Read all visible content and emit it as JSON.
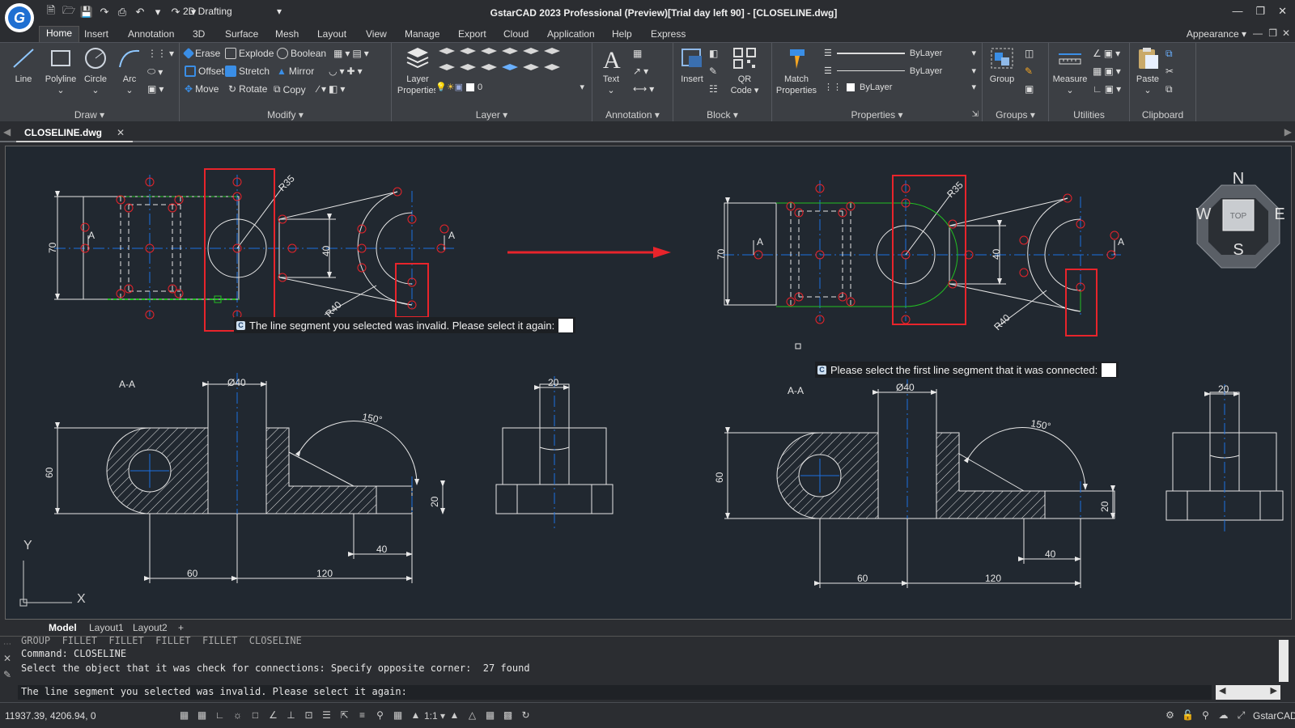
{
  "app": {
    "title": "GstarCAD 2023 Professional (Preview)[Trial day left 90] - [CLOSELINE.dwg]",
    "workspace": "2D Drafting",
    "logo_letter": "G",
    "window_controls": [
      "minimize-icon",
      "restore-icon",
      "close-icon"
    ]
  },
  "menu": {
    "items": [
      "Home",
      "Insert",
      "Annotation",
      "3D",
      "Surface",
      "Mesh",
      "Layout",
      "View",
      "Manage",
      "Export",
      "Cloud",
      "Application",
      "Help",
      "Express"
    ],
    "active": "Home",
    "appearance": "Appearance"
  },
  "ribbon": {
    "draw": {
      "label": "Draw",
      "line": "Line",
      "polyline": "Polyline",
      "circle": "Circle",
      "arc": "Arc"
    },
    "modify": {
      "label": "Modify",
      "erase": "Erase",
      "explode": "Explode",
      "boolean": "Boolean",
      "offset": "Offset",
      "stretch": "Stretch",
      "mirror": "Mirror",
      "move": "Move",
      "rotate": "Rotate",
      "copy": "Copy"
    },
    "layer": {
      "label": "Layer",
      "layer_properties_1": "Layer",
      "layer_properties_2": "Properties",
      "current_layer": "0"
    },
    "annotation": {
      "label": "Annotation",
      "text": "Text"
    },
    "block": {
      "label": "Block",
      "insert": "Insert",
      "qr_1": "QR",
      "qr_2": "Code"
    },
    "properties": {
      "label": "Properties",
      "match_1": "Match",
      "match_2": "Properties",
      "color": "ByLayer",
      "linetype": "ByLayer",
      "lineweight": "ByLayer"
    },
    "groups": {
      "label": "Groups",
      "group": "Group"
    },
    "utilities": {
      "label": "Utilities",
      "measure": "Measure"
    },
    "clipboard": {
      "label": "Clipboard",
      "paste": "Paste"
    }
  },
  "document_tab": "CLOSELINE.dwg",
  "layout_tabs": [
    "Model",
    "Layout1",
    "Layout2",
    "+"
  ],
  "canvas": {
    "prompt_left": "The line segment you selected was invalid. Please select it again:",
    "prompt_right": "Please select the first line segment that it was connected:",
    "section_label": "A-A",
    "section_marker": "A",
    "viewcube": {
      "top": "TOP",
      "north": "N",
      "south": "S",
      "east": "E",
      "west": "W"
    },
    "ucs_y": "Y",
    "ucs_x": "X",
    "dims": {
      "d70": "70",
      "d40": "40",
      "r35": "R35",
      "r40": "R40",
      "dia40": "Ø40",
      "d20": "20",
      "a150": "150°",
      "d60": "60",
      "d120": "120"
    }
  },
  "command_history": [
    "GROUP  FILLET  FILLET  FILLET  FILLET  CLOSELINE",
    "Command: CLOSELINE",
    "Select the object that it was check for connections: Specify opposite corner:  27 found",
    "The line segment you selected was invalid. Please select it again:"
  ],
  "status": {
    "coords": "11937.39, 4206.94, 0",
    "scale": "1:1",
    "brand": "GstarCAD"
  },
  "colors": {
    "canvas_bg": "#212830",
    "ribbon_bg": "#3c3f44",
    "highlight_red": "#e8242b",
    "center_line": "#1a6fe0",
    "accent_green": "#22c022"
  }
}
